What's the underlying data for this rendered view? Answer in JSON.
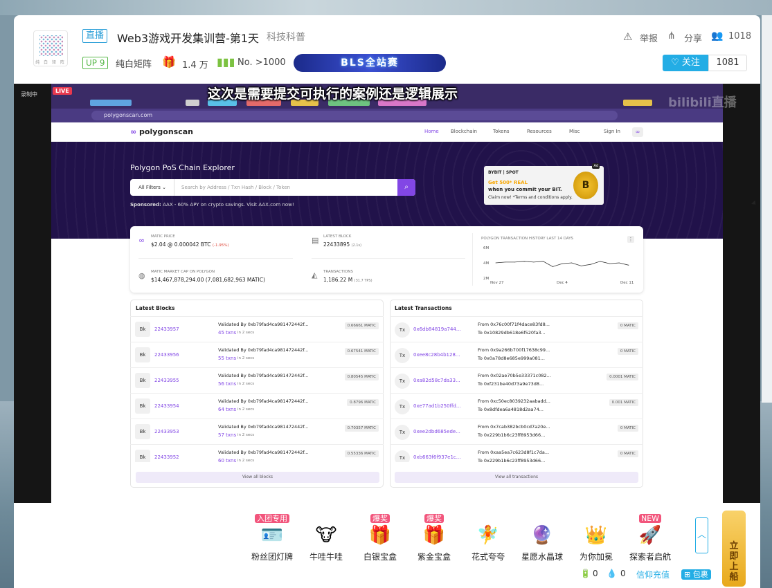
{
  "header": {
    "live_tag": "直播",
    "title": "Web3游戏开发集训营-第1天",
    "category": "科技科普",
    "up_level": "UP 9",
    "streamer": "纯白矩阵",
    "popularity": "1.4 万",
    "rank": "No. >1000",
    "banner_text": "BLS全站赛",
    "report": "举报",
    "share": "分享",
    "viewers": "1018",
    "follow": "关注",
    "follow_count": "1081",
    "logo_text": "纯 白 矩 阵"
  },
  "video": {
    "rec_label": "录制中",
    "live_badge": "LIVE",
    "subtitle": "这次是需要提交可执行的案例还是逻辑展示",
    "url": "polygonscan.com",
    "watermark": "bilibili直播"
  },
  "site": {
    "logo": "polygonscan",
    "nav": [
      "Home",
      "Blockchain",
      "Tokens",
      "Resources",
      "Misc",
      "Sign In"
    ],
    "hero_title": "Polygon PoS Chain Explorer",
    "filter": "All Filters",
    "search_placeholder": "Search by Address / Txn Hash / Block / Token",
    "sponsored": "Sponsored:",
    "sponsored_text": "AAX - 60% APY on crypto savings. Visit AAX.com now!",
    "ad": {
      "brand": "BYBIT | SPOT",
      "line1": "Get 500* REAL",
      "line2": "when you commit your BIT.",
      "line3": "Claim now!  *Terms and conditions apply.",
      "tag": "Ad"
    },
    "stats": {
      "matic_price_label": "MATIC PRICE",
      "matic_price": "$2.04 @ 0.000042 BTC",
      "matic_change": "(-1.95%)",
      "latest_block_label": "LATEST BLOCK",
      "latest_block": "22433895",
      "latest_block_time": "(2.1s)",
      "market_cap_label": "MATIC MARKET CAP ON POLYGON",
      "market_cap": "$14,467,878,294.00",
      "market_cap_matic": "(7,081,682,963 MATIC)",
      "transactions_label": "TRANSACTIONS",
      "transactions": "1,186.22 M",
      "tps": "(31.7 TPS)",
      "history_label": "POLYGON TRANSACTION HISTORY LAST 14 DAYS"
    },
    "blocks_title": "Latest Blocks",
    "txs_title": "Latest Transactions",
    "view_blocks": "View all blocks",
    "view_txs": "View all transactions",
    "blocks": [
      {
        "icon": "Bk",
        "num": "22433957",
        "validator": "Validated By 0xb79fad4ca981472442f...",
        "txns": "45 txns",
        "time": "in 2 secs",
        "reward": "0.66661 MATIC"
      },
      {
        "icon": "Bk",
        "num": "22433956",
        "validator": "Validated By 0xb79fad4ca981472442f...",
        "txns": "55 txns",
        "time": "in 2 secs",
        "reward": "0.67541 MATIC"
      },
      {
        "icon": "Bk",
        "num": "22433955",
        "validator": "Validated By 0xb79fad4ca981472442f...",
        "txns": "56 txns",
        "time": "in 2 secs",
        "reward": "0.80545 MATIC"
      },
      {
        "icon": "Bk",
        "num": "22433954",
        "validator": "Validated By 0xb79fad4ca981472442f...",
        "txns": "64 txns",
        "time": "in 2 secs",
        "reward": "0.8796 MATIC"
      },
      {
        "icon": "Bk",
        "num": "22433953",
        "validator": "Validated By 0xb79fad4ca981472442f...",
        "txns": "57 txns",
        "time": "in 2 secs",
        "reward": "0.70357 MATIC"
      },
      {
        "icon": "Bk",
        "num": "22433952",
        "validator": "Validated By 0xb79fad4ca981472442f...",
        "txns": "60 txns",
        "time": "in 2 secs",
        "reward": "0.55336 MATIC"
      }
    ],
    "txs": [
      {
        "icon": "Tx",
        "hash": "0x6db84819a744...",
        "from": "From 0x76c00f71f4dace83fd8...",
        "to": "To 0x10829db618e6f520fa3...",
        "amount": "0 MATIC"
      },
      {
        "icon": "Tx",
        "hash": "0xee8c28b4b128...",
        "from": "From 0x9a266b700f17638c99...",
        "to": "To 0x0a78d8e685e999a081...",
        "amount": "0 MATIC"
      },
      {
        "icon": "Tx",
        "hash": "0xa82d58c7da33...",
        "from": "From 0x02ae70b5e33371c082...",
        "to": "To 0xf231be40d73a9e73d8...",
        "amount": "0.0001 MATIC"
      },
      {
        "icon": "Tx",
        "hash": "0xe77ad1b250ffd...",
        "from": "From 0xc50ec8039232aabadd...",
        "to": "To 0x8dfdea6a4818d2aa74...",
        "amount": "0.001 MATIC"
      },
      {
        "icon": "Tx",
        "hash": "0xee2dbd685ede...",
        "from": "From 0x7cab382bcb0cd7a20e...",
        "to": "To 0x229b1b6c23ff8953d66...",
        "amount": "0 MATIC"
      },
      {
        "icon": "Tx",
        "hash": "0xb663f6f937e1c...",
        "from": "From 0xaa5ea7c623d8f1c7da...",
        "to": "To 0x229b1b6c23ff8953d66...",
        "amount": "0 MATIC"
      }
    ]
  },
  "chart_data": {
    "type": "line",
    "title": "POLYGON TRANSACTION HISTORY LAST 14 DAYS",
    "yticks": [
      "6M",
      "4M",
      "2M"
    ],
    "xticks": [
      "Nov 27",
      "Dec 4",
      "Dec 11"
    ],
    "ylim": [
      2,
      6
    ],
    "x": [
      "Nov 27",
      "Nov 28",
      "Nov 29",
      "Nov 30",
      "Dec 1",
      "Dec 2",
      "Dec 3",
      "Dec 4",
      "Dec 5",
      "Dec 6",
      "Dec 7",
      "Dec 8",
      "Dec 9",
      "Dec 10",
      "Dec 11"
    ],
    "values": [
      4.0,
      4.1,
      4.1,
      4.2,
      4.1,
      4.2,
      3.5,
      3.9,
      4.0,
      3.6,
      3.8,
      4.2,
      3.9,
      4.0,
      3.7
    ]
  },
  "gifts": {
    "items": [
      {
        "name": "粉丝团灯牌",
        "tag": "入团专用",
        "icon": "🪪"
      },
      {
        "name": "牛哇牛哇",
        "tag": "",
        "icon": "🐮"
      },
      {
        "name": "白银宝盒",
        "tag": "爆奖",
        "icon": "🎁"
      },
      {
        "name": "紫金宝盒",
        "tag": "爆奖",
        "icon": "🎁"
      },
      {
        "name": "花式夸夸",
        "tag": "",
        "icon": "🧚"
      },
      {
        "name": "星愿水晶球",
        "tag": "",
        "icon": "🔮"
      },
      {
        "name": "为你加冕",
        "tag": "",
        "icon": "👑"
      },
      {
        "name": "探索者启航",
        "tag": "NEW",
        "icon": "🚀"
      }
    ],
    "gold": "0",
    "silver": "0",
    "recharge": "信仰充值",
    "package": "包裹",
    "ship": "立即上船"
  }
}
